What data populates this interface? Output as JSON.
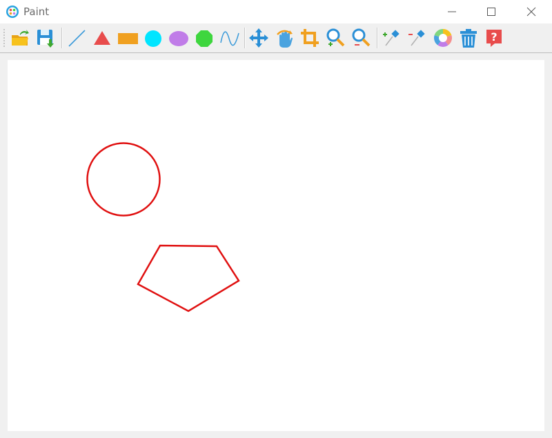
{
  "window": {
    "title": "Paint"
  },
  "toolbar": {
    "tools": [
      {
        "name": "open-file",
        "icon": "open-folder-icon"
      },
      {
        "name": "save-file",
        "icon": "save-icon"
      },
      {
        "name": "line",
        "icon": "line-icon"
      },
      {
        "name": "triangle",
        "icon": "triangle-icon"
      },
      {
        "name": "rectangle",
        "icon": "rectangle-icon"
      },
      {
        "name": "circle",
        "icon": "circle-icon"
      },
      {
        "name": "ellipse",
        "icon": "ellipse-icon"
      },
      {
        "name": "polygon",
        "icon": "octagon-icon"
      },
      {
        "name": "curve",
        "icon": "curve-icon"
      },
      {
        "name": "move",
        "icon": "move-icon"
      },
      {
        "name": "rotate",
        "icon": "rotate-hand-icon"
      },
      {
        "name": "crop",
        "icon": "crop-icon"
      },
      {
        "name": "zoom-in",
        "icon": "zoom-in-icon"
      },
      {
        "name": "zoom-out",
        "icon": "zoom-out-icon"
      },
      {
        "name": "add-point",
        "icon": "add-point-icon"
      },
      {
        "name": "remove-point",
        "icon": "remove-point-icon"
      },
      {
        "name": "color",
        "icon": "color-wheel-icon"
      },
      {
        "name": "delete",
        "icon": "trash-icon"
      },
      {
        "name": "help",
        "icon": "help-icon"
      }
    ],
    "colors": {
      "blue": "#3a9ad9",
      "orange": "#f0a020",
      "red": "#e84c4c",
      "cyan": "#00e5ff",
      "purple": "#c07ce8",
      "green": "#3ed63e"
    }
  },
  "canvas": {
    "stroke_color": "#e01010",
    "shapes": [
      {
        "type": "circle",
        "label": "drawn-circle"
      },
      {
        "type": "polygon",
        "label": "drawn-pentagon"
      }
    ]
  }
}
